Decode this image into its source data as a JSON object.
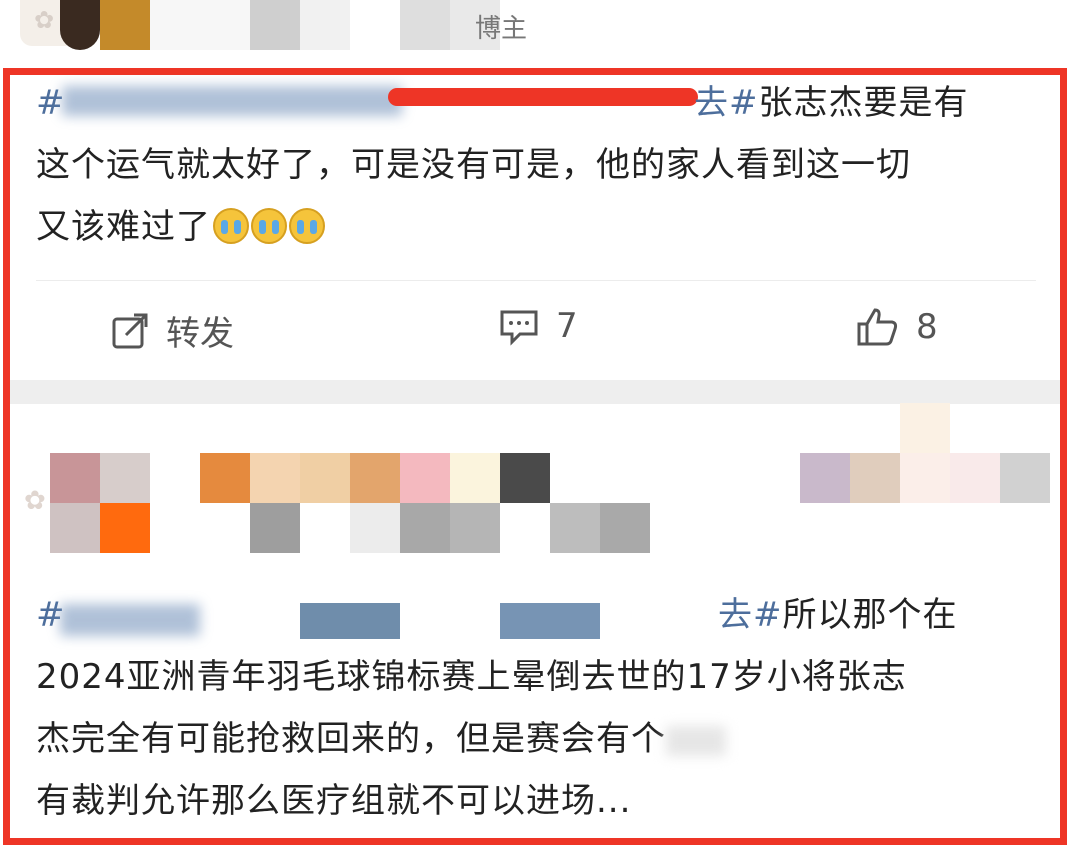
{
  "header": {
    "badge": "博主",
    "avatar_icon": "cartoon-cat-icon"
  },
  "post1": {
    "hashtag_start": "#",
    "hashtag_tail": "去#",
    "line1_rest": "张志杰要是有",
    "line2": "这个运气就太好了，可是没有可是，他的家人看到这一切",
    "line3": "又该难过了",
    "emoji_name": "crying-face-icon",
    "actions": {
      "repost_label": "转发",
      "comment_count": "7",
      "like_count": "8"
    }
  },
  "post2": {
    "hashtag_start": "#",
    "hashtag_tail": "去#",
    "line1_rest": "所以那个在",
    "line2": "2024亚洲青年羽毛球锦标赛上晕倒去世的17岁小将张志",
    "line3": "杰完全有可能抢救回来的，但是赛会有个",
    "line4": "有裁判允许那么医疗组就不可以进场..."
  },
  "colors": {
    "frame": "#ee3526",
    "hashtag": "#4d6e9c",
    "text": "#222222"
  }
}
